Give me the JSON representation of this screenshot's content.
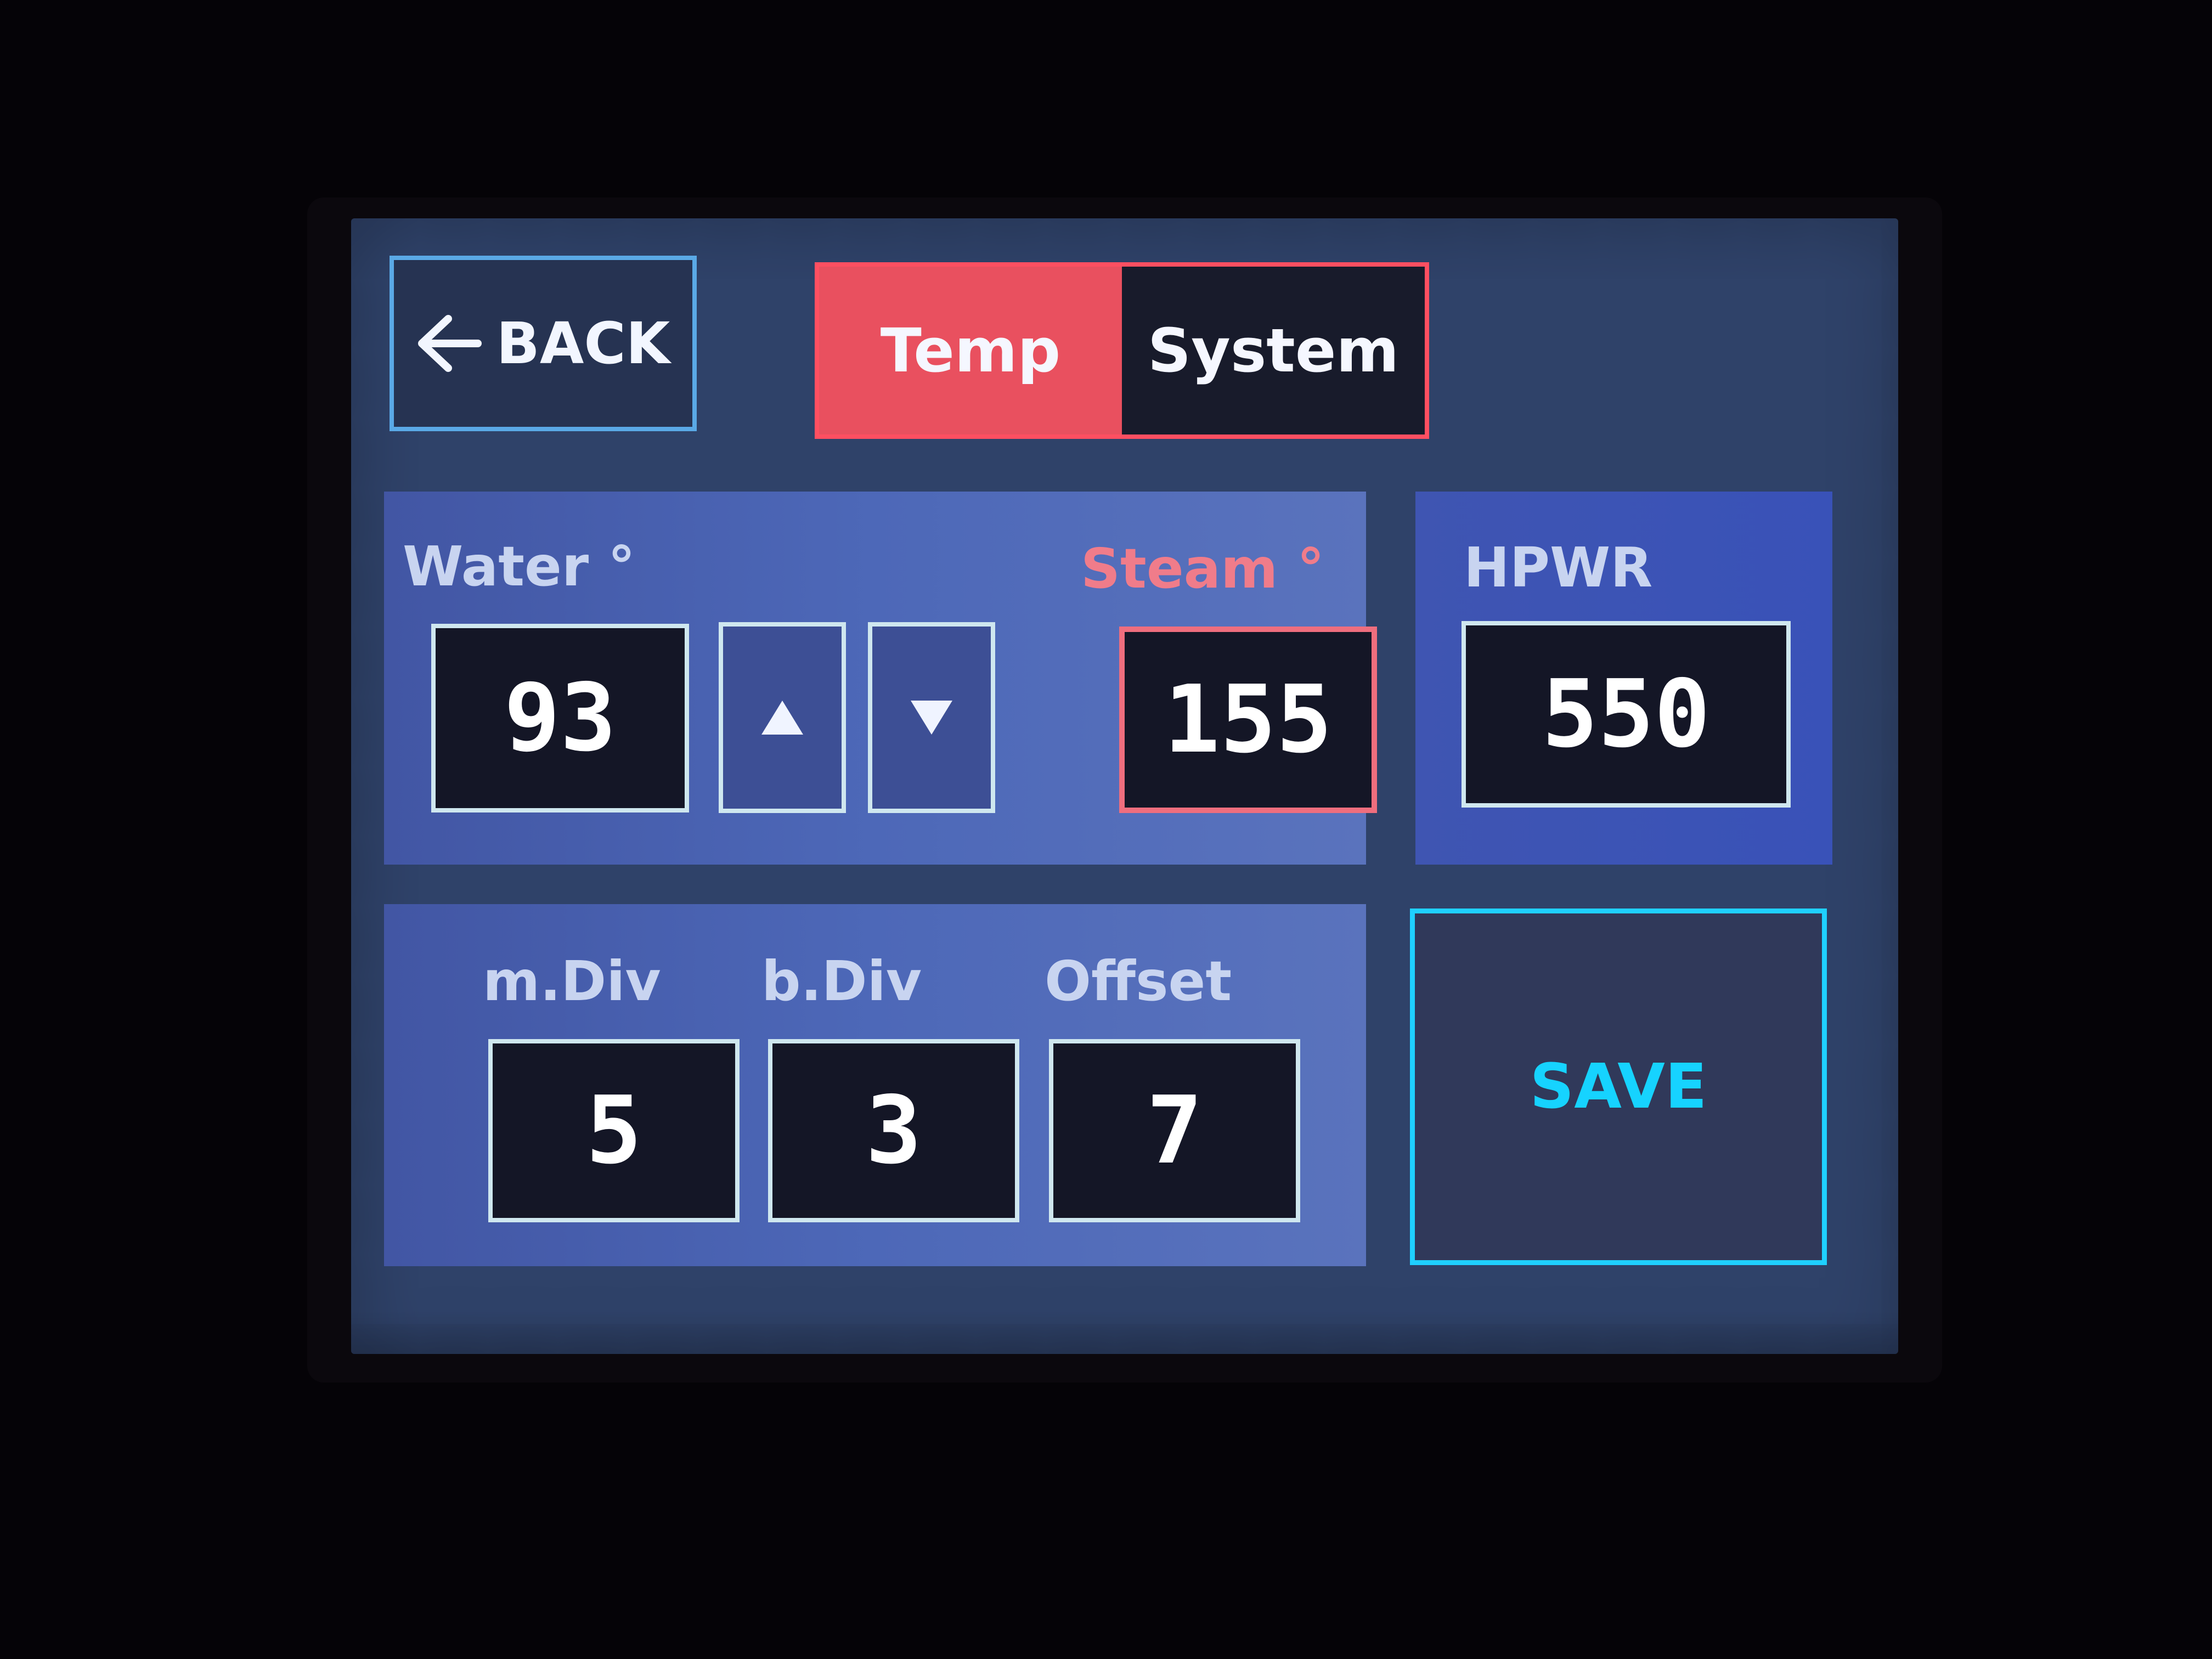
{
  "header": {
    "back_label": "BACK",
    "tabs": [
      {
        "label": "Temp",
        "active": true
      },
      {
        "label": "System",
        "active": false
      }
    ]
  },
  "temperature": {
    "water_label": "Water °",
    "water_value": "93",
    "steam_label": "Steam °",
    "steam_value": "155"
  },
  "power": {
    "label": "HPWR",
    "value": "550"
  },
  "divisions": {
    "m_div_label": "m.Div",
    "m_div_value": "5",
    "b_div_label": "b.Div",
    "b_div_value": "3",
    "offset_label": "Offset",
    "offset_value": "7"
  },
  "actions": {
    "save_label": "SAVE"
  },
  "icons": {
    "back": "arrow-left-icon",
    "increase": "triangle-up-icon",
    "decrease": "triangle-down-icon"
  },
  "colors": {
    "accent_red": "#e9505f",
    "accent_cyan": "#1fd0ff",
    "panel_blue": "#4d68b8"
  }
}
